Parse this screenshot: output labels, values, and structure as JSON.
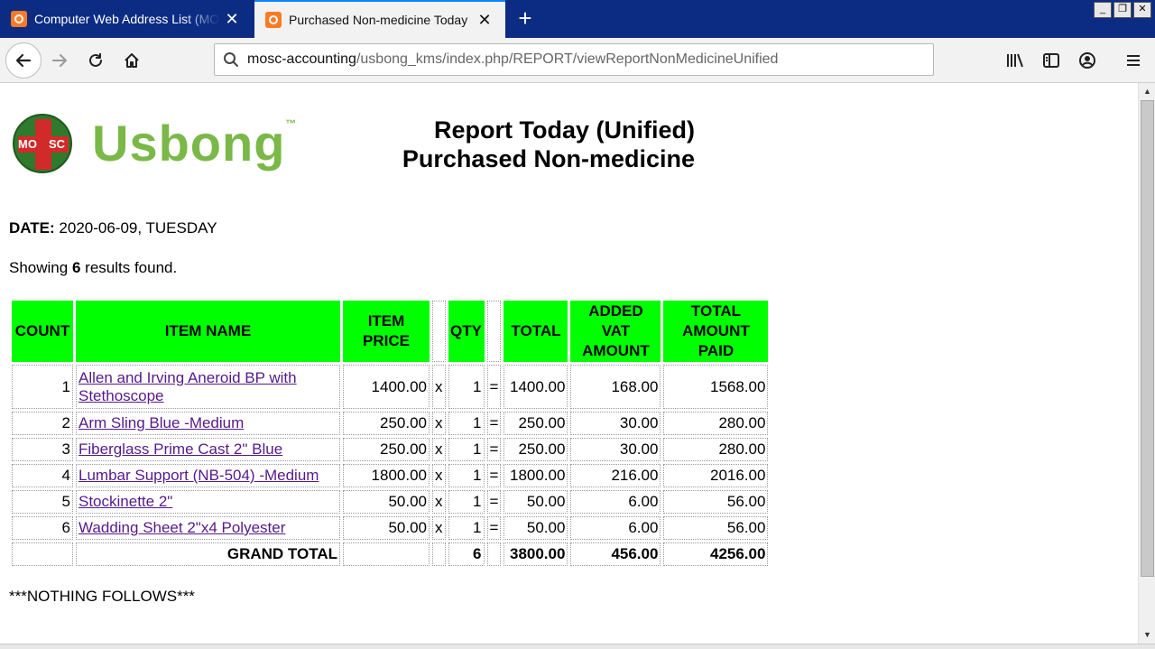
{
  "browser": {
    "tabs": [
      {
        "title": "Computer Web Address List (MOSC",
        "active": false
      },
      {
        "title": "Purchased Non-medicine Today",
        "active": true
      }
    ],
    "url": {
      "host": "mosc-accounting",
      "path": "/usbong_kms/index.php/REPORT/viewReportNonMedicineUnified"
    },
    "window_buttons": [
      "_",
      "❐",
      "✕"
    ]
  },
  "logo": {
    "emblem_left": "MO",
    "emblem_right": "SC",
    "word": "Usbong",
    "tm": "™"
  },
  "report": {
    "title_line1": "Report Today (Unified)",
    "title_line2": "Purchased Non-medicine",
    "date_label": "DATE:",
    "date_value": "2020-06-09, TUESDAY",
    "showing_prefix": "Showing",
    "result_count": "6",
    "showing_suffix": "results found.",
    "footer": "***NOTHING FOLLOWS***"
  },
  "table": {
    "headers": {
      "count": "COUNT",
      "item_name": "ITEM NAME",
      "item_price": [
        "ITEM",
        "PRICE"
      ],
      "qty": "QTY",
      "total": "TOTAL",
      "added_vat": [
        "ADDED",
        "VAT",
        "AMOUNT"
      ],
      "total_paid": [
        "TOTAL",
        "AMOUNT",
        "PAID"
      ]
    },
    "rows": [
      {
        "count": "1",
        "name_line1": "Allen and Irving Aneroid BP with",
        "name_line2": "Stethoscope",
        "price": "1400.00",
        "x": "x",
        "qty": "1",
        "eq": "=",
        "total": "1400.00",
        "vat": "168.00",
        "paid": "1568.00"
      },
      {
        "count": "2",
        "name_line1": "Arm Sling Blue -Medium",
        "name_line2": "",
        "price": "250.00",
        "x": "x",
        "qty": "1",
        "eq": "=",
        "total": "250.00",
        "vat": "30.00",
        "paid": "280.00"
      },
      {
        "count": "3",
        "name_line1": "Fiberglass Prime Cast 2\" Blue",
        "name_line2": "",
        "price": "250.00",
        "x": "x",
        "qty": "1",
        "eq": "=",
        "total": "250.00",
        "vat": "30.00",
        "paid": "280.00"
      },
      {
        "count": "4",
        "name_line1": "Lumbar Support (NB-504) -Medium",
        "name_line2": "",
        "price": "1800.00",
        "x": "x",
        "qty": "1",
        "eq": "=",
        "total": "1800.00",
        "vat": "216.00",
        "paid": "2016.00"
      },
      {
        "count": "5",
        "name_line1": "Stockinette 2\"",
        "name_line2": "",
        "price": "50.00",
        "x": "x",
        "qty": "1",
        "eq": "=",
        "total": "50.00",
        "vat": "6.00",
        "paid": "56.00"
      },
      {
        "count": "6",
        "name_line1": "Wadding Sheet 2\"x4 Polyester",
        "name_line2": "",
        "price": "50.00",
        "x": "x",
        "qty": "1",
        "eq": "=",
        "total": "50.00",
        "vat": "6.00",
        "paid": "56.00"
      }
    ],
    "grand_total": {
      "label": "GRAND TOTAL",
      "qty": "6",
      "total": "3800.00",
      "vat": "456.00",
      "paid": "4256.00"
    }
  },
  "colors": {
    "header_bg": "#00ff00",
    "link": "#551a8b",
    "tabbar": "#0c2c84",
    "logo_green": "#7ab848"
  }
}
